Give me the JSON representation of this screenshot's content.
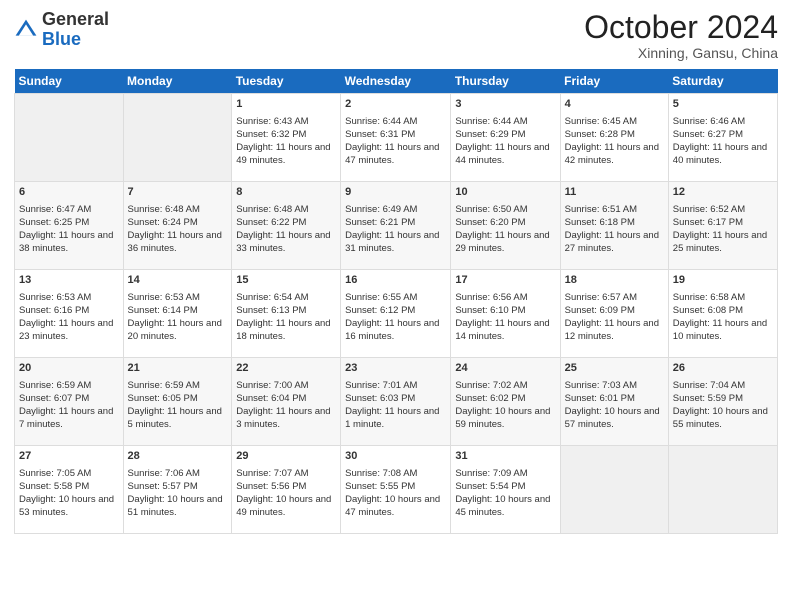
{
  "header": {
    "logo_general": "General",
    "logo_blue": "Blue",
    "title": "October 2024",
    "location": "Xinning, Gansu, China"
  },
  "days_of_week": [
    "Sunday",
    "Monday",
    "Tuesday",
    "Wednesday",
    "Thursday",
    "Friday",
    "Saturday"
  ],
  "weeks": [
    [
      {
        "day": "",
        "sunrise": "",
        "sunset": "",
        "daylight": "",
        "empty": true
      },
      {
        "day": "",
        "sunrise": "",
        "sunset": "",
        "daylight": "",
        "empty": true
      },
      {
        "day": "1",
        "sunrise": "Sunrise: 6:43 AM",
        "sunset": "Sunset: 6:32 PM",
        "daylight": "Daylight: 11 hours and 49 minutes."
      },
      {
        "day": "2",
        "sunrise": "Sunrise: 6:44 AM",
        "sunset": "Sunset: 6:31 PM",
        "daylight": "Daylight: 11 hours and 47 minutes."
      },
      {
        "day": "3",
        "sunrise": "Sunrise: 6:44 AM",
        "sunset": "Sunset: 6:29 PM",
        "daylight": "Daylight: 11 hours and 44 minutes."
      },
      {
        "day": "4",
        "sunrise": "Sunrise: 6:45 AM",
        "sunset": "Sunset: 6:28 PM",
        "daylight": "Daylight: 11 hours and 42 minutes."
      },
      {
        "day": "5",
        "sunrise": "Sunrise: 6:46 AM",
        "sunset": "Sunset: 6:27 PM",
        "daylight": "Daylight: 11 hours and 40 minutes."
      }
    ],
    [
      {
        "day": "6",
        "sunrise": "Sunrise: 6:47 AM",
        "sunset": "Sunset: 6:25 PM",
        "daylight": "Daylight: 11 hours and 38 minutes."
      },
      {
        "day": "7",
        "sunrise": "Sunrise: 6:48 AM",
        "sunset": "Sunset: 6:24 PM",
        "daylight": "Daylight: 11 hours and 36 minutes."
      },
      {
        "day": "8",
        "sunrise": "Sunrise: 6:48 AM",
        "sunset": "Sunset: 6:22 PM",
        "daylight": "Daylight: 11 hours and 33 minutes."
      },
      {
        "day": "9",
        "sunrise": "Sunrise: 6:49 AM",
        "sunset": "Sunset: 6:21 PM",
        "daylight": "Daylight: 11 hours and 31 minutes."
      },
      {
        "day": "10",
        "sunrise": "Sunrise: 6:50 AM",
        "sunset": "Sunset: 6:20 PM",
        "daylight": "Daylight: 11 hours and 29 minutes."
      },
      {
        "day": "11",
        "sunrise": "Sunrise: 6:51 AM",
        "sunset": "Sunset: 6:18 PM",
        "daylight": "Daylight: 11 hours and 27 minutes."
      },
      {
        "day": "12",
        "sunrise": "Sunrise: 6:52 AM",
        "sunset": "Sunset: 6:17 PM",
        "daylight": "Daylight: 11 hours and 25 minutes."
      }
    ],
    [
      {
        "day": "13",
        "sunrise": "Sunrise: 6:53 AM",
        "sunset": "Sunset: 6:16 PM",
        "daylight": "Daylight: 11 hours and 23 minutes."
      },
      {
        "day": "14",
        "sunrise": "Sunrise: 6:53 AM",
        "sunset": "Sunset: 6:14 PM",
        "daylight": "Daylight: 11 hours and 20 minutes."
      },
      {
        "day": "15",
        "sunrise": "Sunrise: 6:54 AM",
        "sunset": "Sunset: 6:13 PM",
        "daylight": "Daylight: 11 hours and 18 minutes."
      },
      {
        "day": "16",
        "sunrise": "Sunrise: 6:55 AM",
        "sunset": "Sunset: 6:12 PM",
        "daylight": "Daylight: 11 hours and 16 minutes."
      },
      {
        "day": "17",
        "sunrise": "Sunrise: 6:56 AM",
        "sunset": "Sunset: 6:10 PM",
        "daylight": "Daylight: 11 hours and 14 minutes."
      },
      {
        "day": "18",
        "sunrise": "Sunrise: 6:57 AM",
        "sunset": "Sunset: 6:09 PM",
        "daylight": "Daylight: 11 hours and 12 minutes."
      },
      {
        "day": "19",
        "sunrise": "Sunrise: 6:58 AM",
        "sunset": "Sunset: 6:08 PM",
        "daylight": "Daylight: 11 hours and 10 minutes."
      }
    ],
    [
      {
        "day": "20",
        "sunrise": "Sunrise: 6:59 AM",
        "sunset": "Sunset: 6:07 PM",
        "daylight": "Daylight: 11 hours and 7 minutes."
      },
      {
        "day": "21",
        "sunrise": "Sunrise: 6:59 AM",
        "sunset": "Sunset: 6:05 PM",
        "daylight": "Daylight: 11 hours and 5 minutes."
      },
      {
        "day": "22",
        "sunrise": "Sunrise: 7:00 AM",
        "sunset": "Sunset: 6:04 PM",
        "daylight": "Daylight: 11 hours and 3 minutes."
      },
      {
        "day": "23",
        "sunrise": "Sunrise: 7:01 AM",
        "sunset": "Sunset: 6:03 PM",
        "daylight": "Daylight: 11 hours and 1 minute."
      },
      {
        "day": "24",
        "sunrise": "Sunrise: 7:02 AM",
        "sunset": "Sunset: 6:02 PM",
        "daylight": "Daylight: 10 hours and 59 minutes."
      },
      {
        "day": "25",
        "sunrise": "Sunrise: 7:03 AM",
        "sunset": "Sunset: 6:01 PM",
        "daylight": "Daylight: 10 hours and 57 minutes."
      },
      {
        "day": "26",
        "sunrise": "Sunrise: 7:04 AM",
        "sunset": "Sunset: 5:59 PM",
        "daylight": "Daylight: 10 hours and 55 minutes."
      }
    ],
    [
      {
        "day": "27",
        "sunrise": "Sunrise: 7:05 AM",
        "sunset": "Sunset: 5:58 PM",
        "daylight": "Daylight: 10 hours and 53 minutes."
      },
      {
        "day": "28",
        "sunrise": "Sunrise: 7:06 AM",
        "sunset": "Sunset: 5:57 PM",
        "daylight": "Daylight: 10 hours and 51 minutes."
      },
      {
        "day": "29",
        "sunrise": "Sunrise: 7:07 AM",
        "sunset": "Sunset: 5:56 PM",
        "daylight": "Daylight: 10 hours and 49 minutes."
      },
      {
        "day": "30",
        "sunrise": "Sunrise: 7:08 AM",
        "sunset": "Sunset: 5:55 PM",
        "daylight": "Daylight: 10 hours and 47 minutes."
      },
      {
        "day": "31",
        "sunrise": "Sunrise: 7:09 AM",
        "sunset": "Sunset: 5:54 PM",
        "daylight": "Daylight: 10 hours and 45 minutes."
      },
      {
        "day": "",
        "sunrise": "",
        "sunset": "",
        "daylight": "",
        "empty": true
      },
      {
        "day": "",
        "sunrise": "",
        "sunset": "",
        "daylight": "",
        "empty": true
      }
    ]
  ]
}
